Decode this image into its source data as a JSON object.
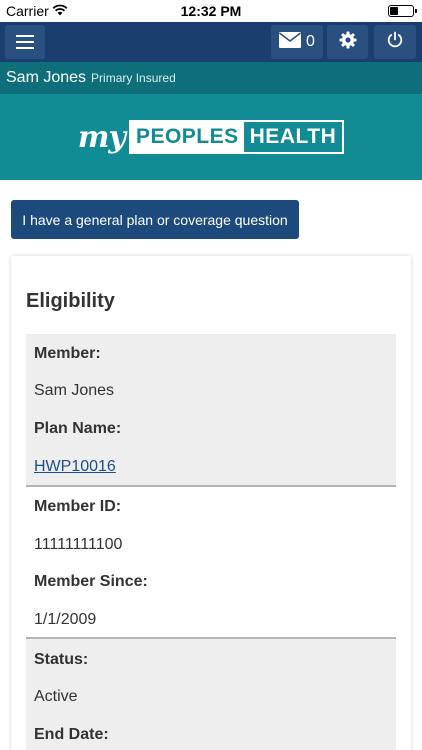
{
  "status_bar": {
    "carrier": "Carrier",
    "time": "12:32 PM"
  },
  "navbar": {
    "mail_count": "0"
  },
  "user": {
    "name": "Sam Jones",
    "role": "Primary Insured"
  },
  "logo": {
    "my": "my",
    "peoples": "PEOPLES",
    "health": "HEALTH"
  },
  "question_button": "I have a general plan or coverage question",
  "eligibility": {
    "title": "Eligibility",
    "sections": [
      {
        "rows": [
          {
            "label": "Member:",
            "value": "Sam Jones"
          },
          {
            "label": "Plan Name:",
            "value": "HWP10016"
          }
        ]
      },
      {
        "rows": [
          {
            "label": "Member ID:",
            "value": "11111111100"
          },
          {
            "label": "Member Since:",
            "value": "1/1/2009"
          }
        ]
      },
      {
        "rows": [
          {
            "label": "Status:",
            "value": "Active"
          },
          {
            "label": "End Date:",
            "value": ""
          }
        ]
      }
    ]
  },
  "colors": {
    "navbar": "#1a3e6e",
    "user_bar": "#0e6f7a",
    "logo_band": "#118b94",
    "button": "#1d4a7c",
    "link": "#1f4e8c"
  }
}
